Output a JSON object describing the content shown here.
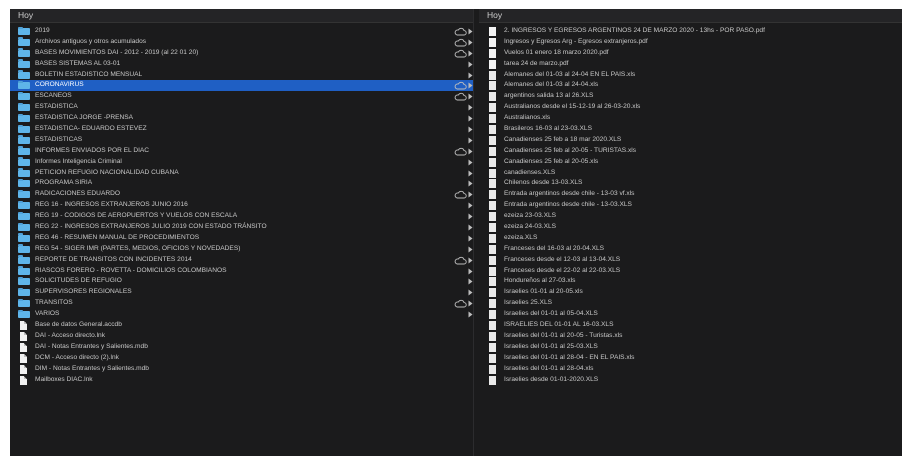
{
  "left_column": {
    "header": "Hoy",
    "items": [
      {
        "name": "2019",
        "kind": "folder",
        "cloud": true
      },
      {
        "name": "Archivos antiguos y otros acumulados",
        "kind": "folder",
        "cloud": true
      },
      {
        "name": "BASES MOVIMIENTOS DAI - 2012 - 2019 (al 22 01 20)",
        "kind": "folder",
        "cloud": true
      },
      {
        "name": "BASES SISTEMAS AL 03-01",
        "kind": "folder",
        "cloud": false
      },
      {
        "name": "BOLETIN ESTADISTICO MENSUAL",
        "kind": "folder",
        "cloud": false
      },
      {
        "name": "CORONAVIRUS",
        "kind": "folder",
        "cloud": true,
        "selected": true
      },
      {
        "name": "ESCANEOS",
        "kind": "folder",
        "cloud": true
      },
      {
        "name": "ESTADISTICA",
        "kind": "folder",
        "cloud": false
      },
      {
        "name": "ESTADISTICA JORGE -PRENSA",
        "kind": "folder",
        "cloud": false
      },
      {
        "name": "ESTADISTICA- EDUARDO ESTEVEZ",
        "kind": "folder",
        "cloud": false
      },
      {
        "name": "ESTADISTICAS",
        "kind": "folder",
        "cloud": false
      },
      {
        "name": "INFORMES ENVIADOS POR EL DIAC",
        "kind": "folder",
        "cloud": true
      },
      {
        "name": "Informes Inteligencia Criminal",
        "kind": "folder",
        "cloud": false
      },
      {
        "name": "PETICION REFUGIO NACIONALIDAD CUBANA",
        "kind": "folder",
        "cloud": false
      },
      {
        "name": "PROGRAMA SIRIA",
        "kind": "folder",
        "cloud": false
      },
      {
        "name": "RADICACIONES EDUARDO",
        "kind": "folder",
        "cloud": true
      },
      {
        "name": "REG 16 - INGRESOS EXTRANJEROS JUNIO 2016",
        "kind": "folder",
        "cloud": false
      },
      {
        "name": "REG 19 - CODIGOS DE AEROPUERTOS Y VUELOS CON ESCALA",
        "kind": "folder",
        "cloud": false
      },
      {
        "name": "REG 22 - INGRESOS EXTRANJEROS JULIO 2019 CON ESTADO TRÁNSITO",
        "kind": "folder",
        "cloud": false
      },
      {
        "name": "REG 46 - RESUMEN MANUAL DE PROCEDIMIENTOS",
        "kind": "folder",
        "cloud": false
      },
      {
        "name": "REG 54 - SIGER IMR (PARTES, MEDIOS, OFICIOS Y NOVEDADES)",
        "kind": "folder",
        "cloud": false
      },
      {
        "name": "REPORTE DE TRANSITOS CON INCIDENTES 2014",
        "kind": "folder",
        "cloud": true
      },
      {
        "name": "RIASCOS FORERO - ROVETTA - DOMICILIOS COLOMBIANOS",
        "kind": "folder",
        "cloud": false
      },
      {
        "name": "SOLICITUDES DE REFUGIO",
        "kind": "folder",
        "cloud": false
      },
      {
        "name": "SUPERVISORES REGIONALES",
        "kind": "folder",
        "cloud": false
      },
      {
        "name": "TRANSITOS",
        "kind": "folder",
        "cloud": true
      },
      {
        "name": "VARIOS",
        "kind": "folder",
        "cloud": false
      },
      {
        "name": "Base de datos General.accdb",
        "kind": "file",
        "cloud": false
      },
      {
        "name": "DAI - Acceso directo.lnk",
        "kind": "file",
        "cloud": false
      },
      {
        "name": "DAI - Notas Entrantes y Salientes.mdb",
        "kind": "file",
        "cloud": false
      },
      {
        "name": "DCM - Acceso directo (2).lnk",
        "kind": "file",
        "cloud": false
      },
      {
        "name": "DIM - Notas Entrantes y Salientes.mdb",
        "kind": "file",
        "cloud": false
      },
      {
        "name": "Mailboxes DIAC.lnk",
        "kind": "file",
        "cloud": false
      }
    ]
  },
  "right_column": {
    "header": "Hoy",
    "items": [
      {
        "name": "2. INGRESOS Y EGRESOS ARGENTINOS 24 DE MARZO 2020 - 13hs - POR PASO.pdf",
        "kind": "pdf"
      },
      {
        "name": "Ingresos y Egresos Arg - Egresos extranjeros.pdf",
        "kind": "pdf"
      },
      {
        "name": "Vuelos 01 enero 18 marzo 2020.pdf",
        "kind": "pdf"
      },
      {
        "name": "tarea 24 de marzo.pdf",
        "kind": "pdf"
      },
      {
        "name": "Alemanes del 01-03 al 24-04 EN EL PAIS.xls",
        "kind": "xls"
      },
      {
        "name": "Alemanes del 01-03 al 24-04.xls",
        "kind": "xls"
      },
      {
        "name": "argentinos salida 13 al 26.XLS",
        "kind": "xls"
      },
      {
        "name": "Australianos desde el 15-12-19 al 26-03-20.xls",
        "kind": "xls"
      },
      {
        "name": "Australianos.xls",
        "kind": "xls"
      },
      {
        "name": "Brasileros 16-03 al 23-03.XLS",
        "kind": "xls"
      },
      {
        "name": "Canadienses 25 feb a 18 mar 2020.XLS",
        "kind": "xls"
      },
      {
        "name": "Canadienses 25 feb al 20-05 - TURISTAS.xls",
        "kind": "xls"
      },
      {
        "name": "Canadienses 25 feb al 20-05.xls",
        "kind": "xls"
      },
      {
        "name": "canadienses.XLS",
        "kind": "xls"
      },
      {
        "name": "Chilenos desde 13-03.XLS",
        "kind": "xls"
      },
      {
        "name": "Entrada argentinos desde chile - 13-03 vf.xls",
        "kind": "xls"
      },
      {
        "name": "Entrada argentinos desde chile - 13-03.XLS",
        "kind": "xls"
      },
      {
        "name": "ezeiza 23-03.XLS",
        "kind": "xls"
      },
      {
        "name": "ezeiza 24-03.XLS",
        "kind": "xls"
      },
      {
        "name": "ezeiza.XLS",
        "kind": "xls"
      },
      {
        "name": "Franceses del 16-03 al 20-04.XLS",
        "kind": "xls"
      },
      {
        "name": "Franceses desde el 12-03 al 13-04.XLS",
        "kind": "xls"
      },
      {
        "name": "Franceses desde el 22-02 al 22-03.XLS",
        "kind": "xls"
      },
      {
        "name": "Hondureños al 27-03.xls",
        "kind": "xls"
      },
      {
        "name": "Israelies 01-01 al 20-05.xls",
        "kind": "xls"
      },
      {
        "name": "Israelies 25.XLS",
        "kind": "xls"
      },
      {
        "name": "Israelies del 01-01 al 05-04.XLS",
        "kind": "xls"
      },
      {
        "name": "ISRAELIES DEL 01-01 AL 16-03.XLS",
        "kind": "xls"
      },
      {
        "name": "Israelies del 01-01 al 20-05 - Turistas.xls",
        "kind": "xls"
      },
      {
        "name": "Israelies del 01-01 al 25-03.XLS",
        "kind": "xls"
      },
      {
        "name": "Israelies del 01-01 al 28-04 - EN EL PAIS.xls",
        "kind": "xls"
      },
      {
        "name": "Israelies del 01-01 al 28-04.xls",
        "kind": "xls"
      },
      {
        "name": "Israelies desde 01-01-2020.XLS",
        "kind": "xls"
      }
    ]
  },
  "colors": {
    "background": "#1b1b1c",
    "selection": "#1f5fc4",
    "folder": "#5fb5e9",
    "text": "#c9c9c9"
  },
  "icons": {
    "folder": "folder-icon",
    "file": "file-icon",
    "pdf": "pdf-icon",
    "xls": "spreadsheet-icon",
    "cloud": "cloud-icon",
    "chevron": "chevron-right-icon"
  }
}
